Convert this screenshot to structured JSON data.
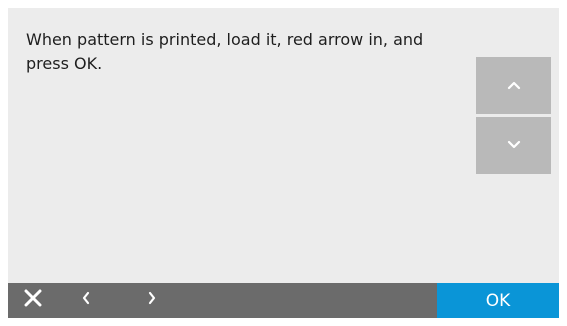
{
  "message": {
    "text": "When pattern is printed, load it, red arrow in, and press OK."
  },
  "scroll": {
    "up_icon": "chevron-up-icon",
    "down_icon": "chevron-down-icon"
  },
  "footer": {
    "close_icon": "close-icon",
    "prev_icon": "chevron-left-icon",
    "next_icon": "chevron-right-icon",
    "ok_label": "OK"
  },
  "colors": {
    "background": "#ececec",
    "scroll_button": "#b9b9b9",
    "footer_bar": "#6b6b6b",
    "ok_button": "#0a95d7",
    "text": "#1e1e1e"
  }
}
